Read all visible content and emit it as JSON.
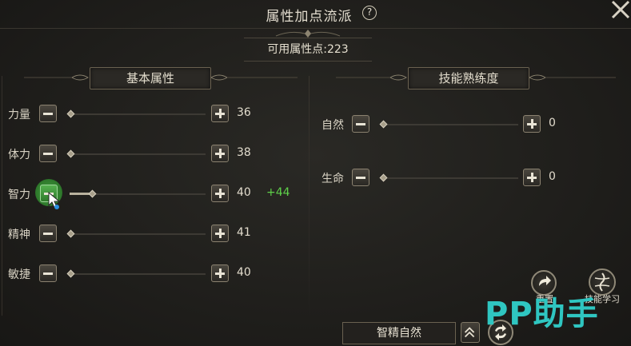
{
  "window": {
    "title": "属性加点流派",
    "help_glyph": "?",
    "available_points": "可用属性点:223"
  },
  "left_panel": {
    "header": "基本属性",
    "attributes": [
      {
        "label": "力量",
        "value": "36",
        "bonus": "",
        "fill": 0.0
      },
      {
        "label": "体力",
        "value": "38",
        "bonus": "",
        "fill": 0.0
      },
      {
        "label": "智力",
        "value": "40",
        "bonus": "+44",
        "fill": 0.16
      },
      {
        "label": "精神",
        "value": "41",
        "bonus": "",
        "fill": 0.0
      },
      {
        "label": "敏捷",
        "value": "40",
        "bonus": "",
        "fill": 0.0
      }
    ]
  },
  "right_panel": {
    "header": "技能熟练度",
    "skills": [
      {
        "label": "自然",
        "value": "0",
        "fill": 0.0
      },
      {
        "label": "生命",
        "value": "0",
        "fill": 0.0
      }
    ]
  },
  "actions": {
    "reset_label": "重置",
    "skill_learn_label": "技能学习",
    "school_name": "智精自然"
  },
  "watermark": "PP助手",
  "colors": {
    "bonus": "#5fd24a",
    "watermark": "#2fc6c1",
    "highlight": "#3f9c3b"
  }
}
